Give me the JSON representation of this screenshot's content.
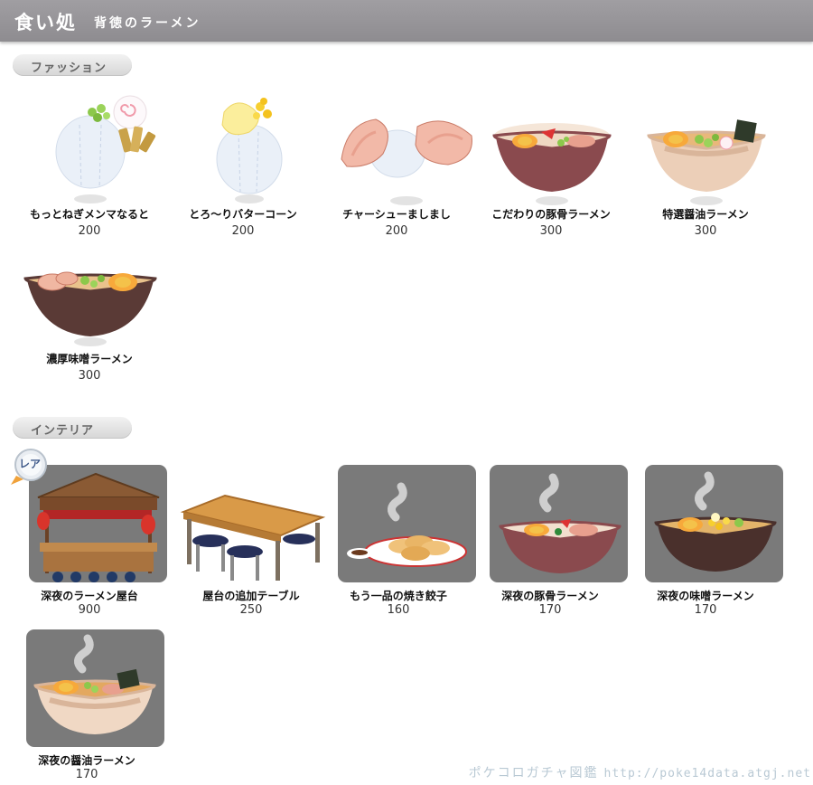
{
  "header": {
    "title": "食い処",
    "subtitle": "背徳のラーメン"
  },
  "sections": {
    "fashion": {
      "label": "ファッション"
    },
    "interior": {
      "label": "インテリア"
    }
  },
  "fashion_items": [
    {
      "name": "もっとねぎメンマなると",
      "price": "200"
    },
    {
      "name": "とろ〜りバターコーン",
      "price": "200"
    },
    {
      "name": "チャーシューましまし",
      "price": "200"
    },
    {
      "name": "こだわりの豚骨ラーメン",
      "price": "300"
    },
    {
      "name": "特選醤油ラーメン",
      "price": "300"
    },
    {
      "name": "濃厚味噌ラーメン",
      "price": "300"
    }
  ],
  "interior_items": [
    {
      "name": "深夜のラーメン屋台",
      "price": "900",
      "badge": "レア"
    },
    {
      "name": "屋台の追加テーブル",
      "price": "250"
    },
    {
      "name": "もう一品の焼き餃子",
      "price": "160"
    },
    {
      "name": "深夜の豚骨ラーメン",
      "price": "170"
    },
    {
      "name": "深夜の味噌ラーメン",
      "price": "170"
    },
    {
      "name": "深夜の醤油ラーメン",
      "price": "170"
    }
  ],
  "footer": {
    "site_name": "ポケコロガチャ図鑑",
    "url": "http://poke14data.atgj.net"
  },
  "colors": {
    "header": "#8e8c90",
    "panel": "#7a7a7a",
    "footer_text": "#b9c9d4"
  }
}
